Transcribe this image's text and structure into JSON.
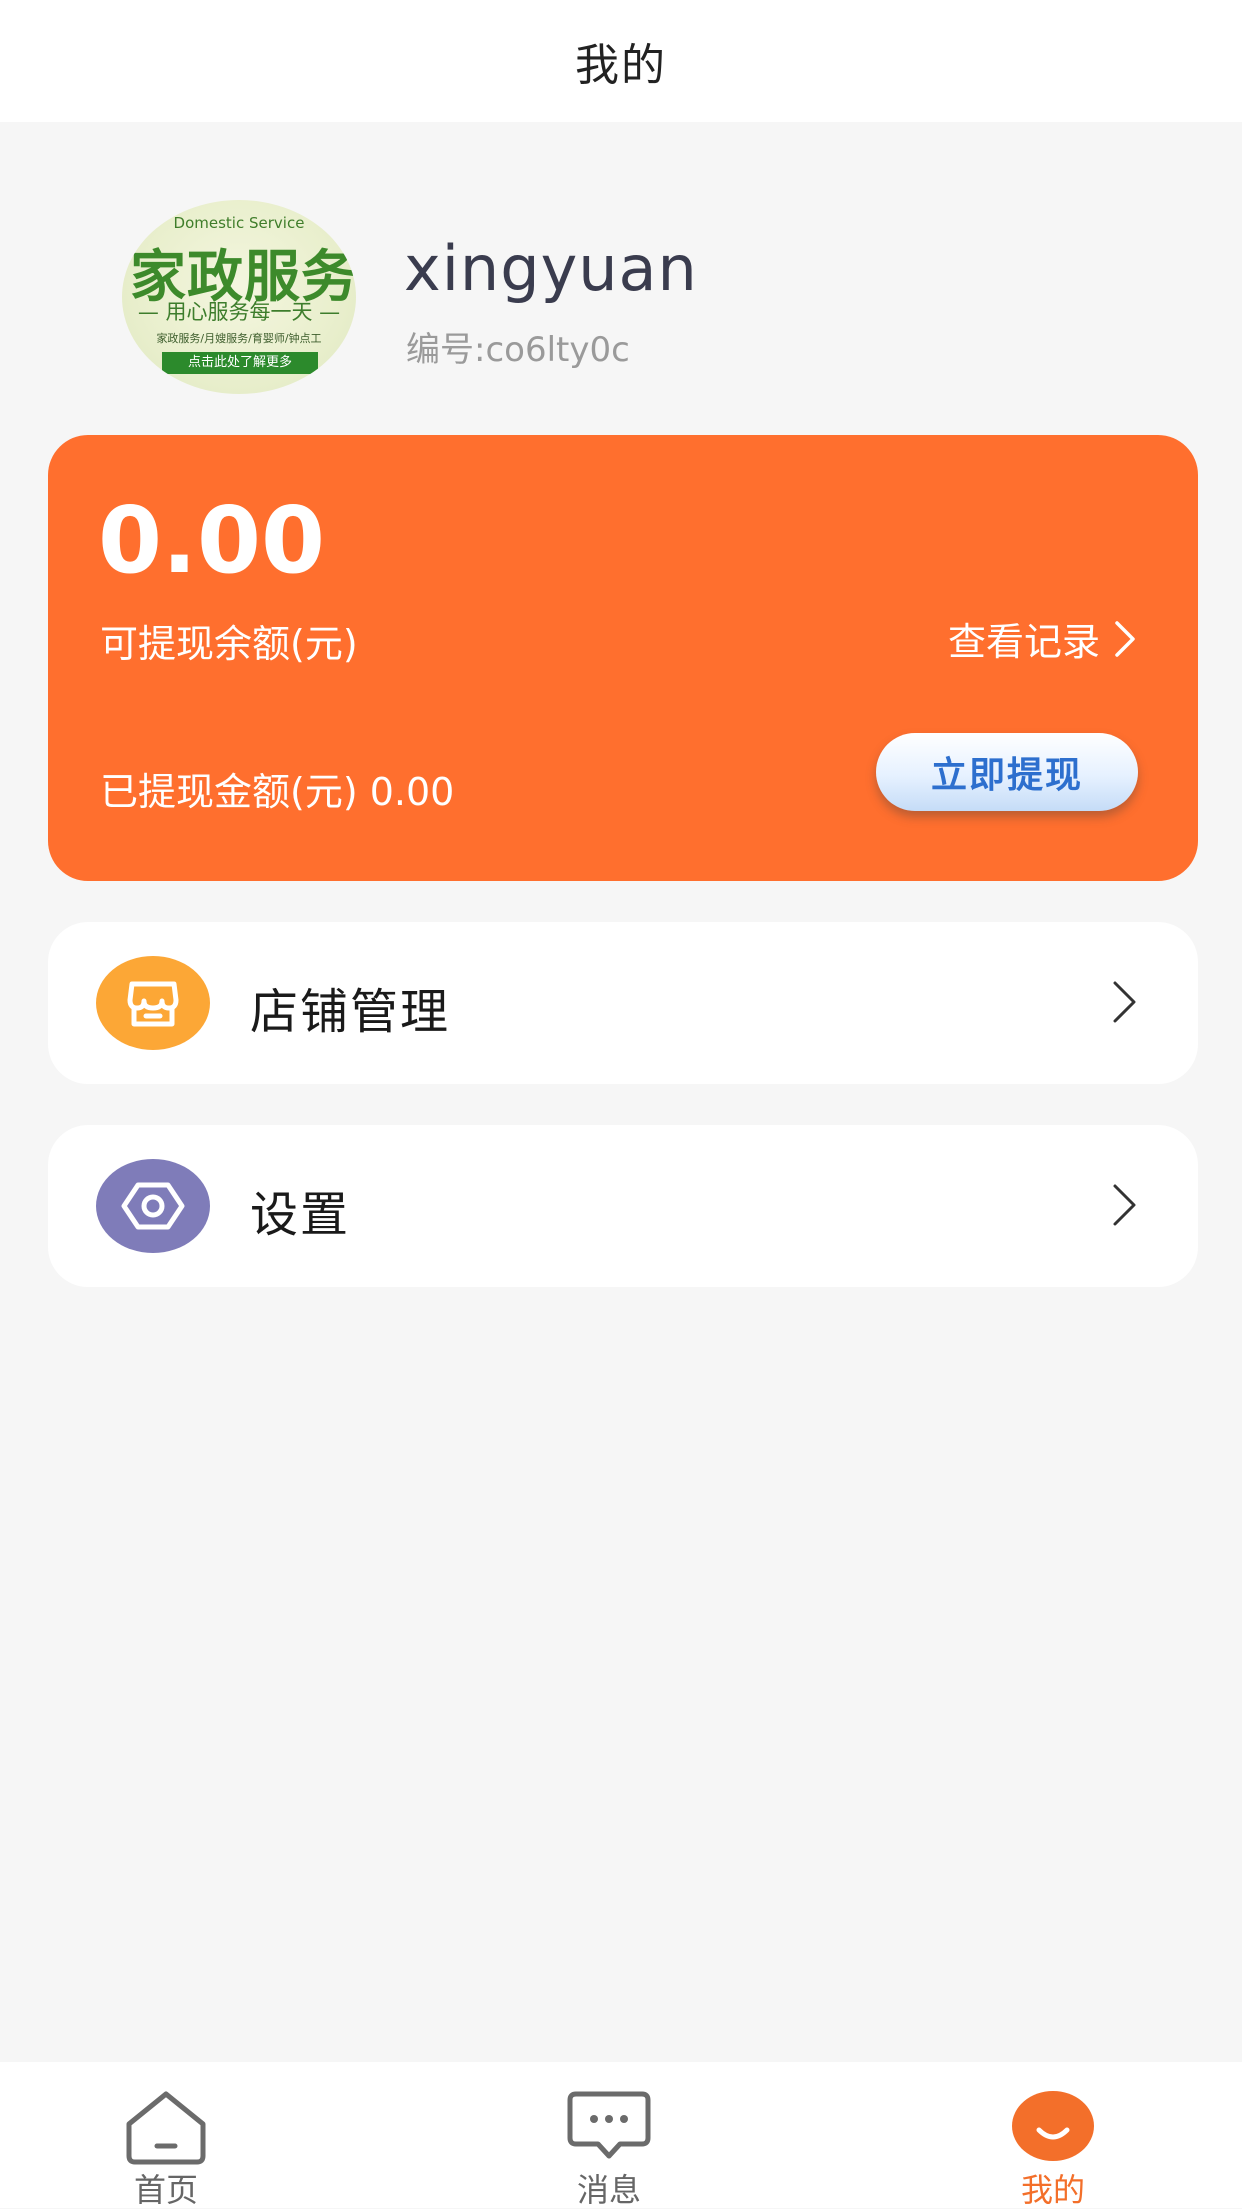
{
  "header": {
    "title": "我的"
  },
  "profile": {
    "avatar": {
      "en_text": "Domestic Service",
      "big_text": "家政服务",
      "slogan": "— 用心服务每一天 —",
      "services": "家政服务/月嫂服务/育婴师/钟点工",
      "cta": "点击此处了解更多"
    },
    "username": "xingyuan",
    "user_id": "编号:co6lty0c"
  },
  "balance_card": {
    "amount": "0.00",
    "amount_label": "可提现余额(元)",
    "records_link": "查看记录",
    "withdrawn_text": "已提现金额(元) 0.00",
    "withdraw_button": "立即提现",
    "bg_color": "#ff6f2e"
  },
  "menu": [
    {
      "label": "店铺管理",
      "icon": "shop-icon",
      "icon_color": "#fca736"
    },
    {
      "label": "设置",
      "icon": "settings-icon",
      "icon_color": "#7f7cb9"
    }
  ],
  "tabbar": {
    "items": [
      {
        "label": "首页",
        "icon": "home-icon",
        "active": false
      },
      {
        "label": "消息",
        "icon": "message-icon",
        "active": false
      },
      {
        "label": "我的",
        "icon": "smile-icon",
        "active": true
      }
    ],
    "active_color": "#f36f2a"
  }
}
